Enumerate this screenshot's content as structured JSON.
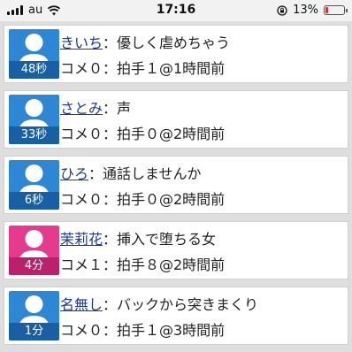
{
  "status_bar": {
    "carrier": "au",
    "time": "17:16",
    "battery": "13%",
    "battery_level": 0.13,
    "battery_color": "#e0302a"
  },
  "colors": {
    "avatar_blue": "#2f86d2",
    "avatar_blue_dark": "#1a5fa3",
    "avatar_pink": "#e43b8f",
    "avatar_pink_dark": "#b8226d",
    "name_link": "#1e3a8a"
  },
  "posts": [
    {
      "name": "きいち",
      "text": "優しく虐めちゃう",
      "age": "48秒",
      "comments": "コメ０：拍手１@1時間前",
      "avatar": "blue"
    },
    {
      "name": "さとみ",
      "text": "声",
      "age": "33秒",
      "comments": "コメ０：拍手０@2時間前",
      "avatar": "blue"
    },
    {
      "name": "ひろ",
      "text": "通話しませんか",
      "age": "6秒",
      "comments": "コメ０：拍手０@2時間前",
      "avatar": "blue"
    },
    {
      "name": "茉莉花",
      "text": "挿入で堕ちる女",
      "age": "4分",
      "comments": "コメ１：拍手８@2時間前",
      "avatar": "pink"
    },
    {
      "name": "名無し",
      "text": "バックから突きまくり",
      "age": "1分",
      "comments": "コメ０：拍手１@3時間前",
      "avatar": "blue"
    }
  ],
  "separator": "："
}
